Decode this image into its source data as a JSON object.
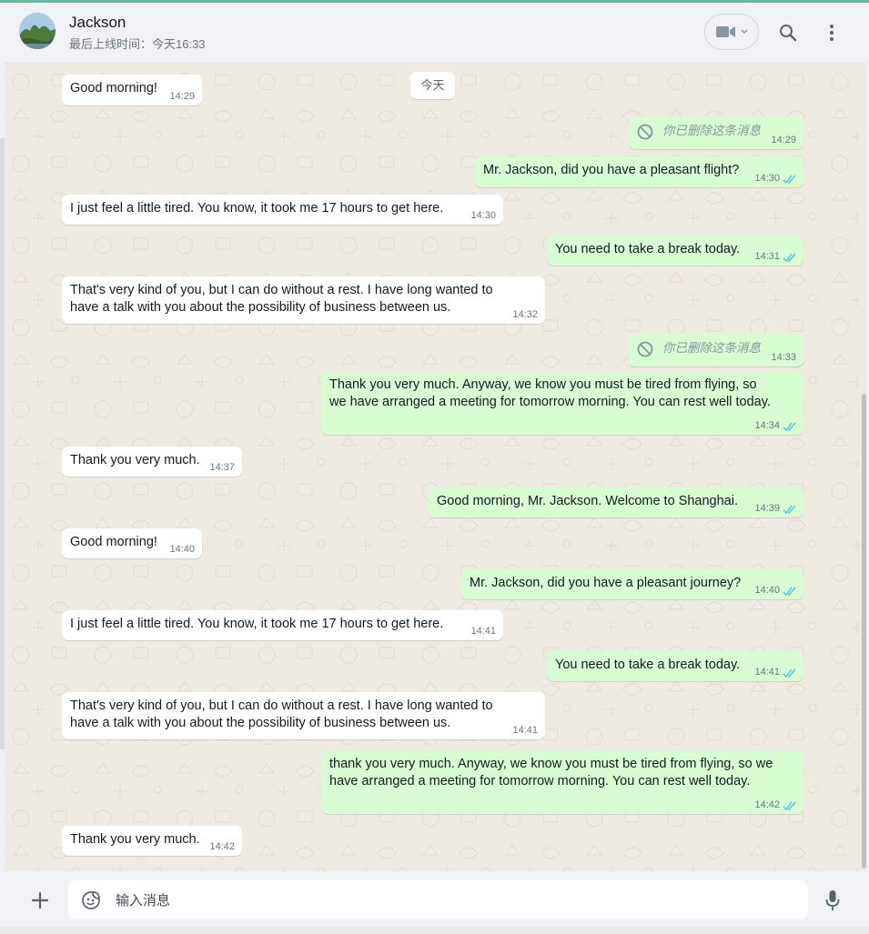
{
  "header": {
    "contact_name": "Jackson",
    "last_seen": "最后上线时间：今天16:33",
    "icons": [
      "video-call-icon",
      "chevron-down-icon",
      "search-icon",
      "menu-dots-icon"
    ]
  },
  "chat": {
    "date_chip": "今天",
    "messages": [
      {
        "dir": "in",
        "text": "Good morning!",
        "time": "14:29"
      },
      {
        "dir": "out",
        "deleted": true,
        "text": "你已删除这条消息",
        "time": "14:29"
      },
      {
        "dir": "out",
        "text": "Mr. Jackson, did you have a pleasant flight?",
        "time": "14:30"
      },
      {
        "dir": "in",
        "text": "I just feel a little tired. You know, it took me 17 hours to get here.",
        "time": "14:30"
      },
      {
        "dir": "out",
        "text": "You need to take a break today.",
        "time": "14:31"
      },
      {
        "dir": "in",
        "line1": "That's very kind of you, but I can do without a rest. I have long wanted to",
        "line2": "have a talk with you about the possibility of business between us.",
        "time": "14:32"
      },
      {
        "dir": "out",
        "deleted": true,
        "text": "你已删除这条消息",
        "time": "14:33"
      },
      {
        "dir": "out",
        "line1": "Thank you very much. Anyway, we know you must be tired from flying, so",
        "line2": "we have arranged a meeting for tomorrow morning. You can rest well today.",
        "time": "14:34"
      },
      {
        "dir": "in",
        "text": "Thank you very much.",
        "time": "14:37"
      },
      {
        "dir": "out",
        "text": "Good morning, Mr. Jackson. Welcome to Shanghai.",
        "time": "14:39"
      },
      {
        "dir": "in",
        "text": "Good morning!",
        "time": "14:40"
      },
      {
        "dir": "out",
        "text": "Mr. Jackson, did you have a pleasant journey?",
        "time": "14:40"
      },
      {
        "dir": "in",
        "text": "I just feel a little tired. You know, it took me 17 hours to get here.",
        "time": "14:41"
      },
      {
        "dir": "out",
        "text": "You need to take a break today.",
        "time": "14:41"
      },
      {
        "dir": "in",
        "line1": "That's very kind of you, but I can do without a rest. I have long wanted to",
        "line2": "have a talk with you about the possibility of business between us.",
        "time": "14:41"
      },
      {
        "dir": "out",
        "line1": "thank you very much. Anyway, we know you must be tired from flying, so we",
        "line2": "have arranged a meeting for tomorrow morning. You can rest well today.",
        "time": "14:42"
      },
      {
        "dir": "in",
        "text": "Thank you very much.",
        "time": "14:42"
      }
    ]
  },
  "composer": {
    "placeholder": "输入消息",
    "icons": [
      "plus-icon",
      "sticker-icon",
      "microphone-icon"
    ]
  },
  "colors": {
    "incoming_bubble": "#ffffff",
    "outgoing_bubble": "#d9fdd3",
    "read_ticks": "#53bdeb",
    "chat_background": "#efeae2"
  }
}
